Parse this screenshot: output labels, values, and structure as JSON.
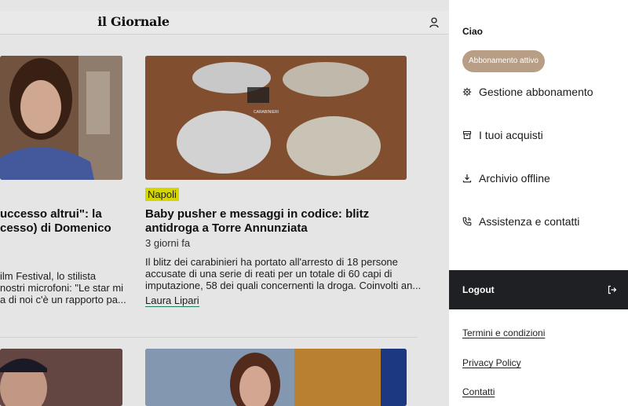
{
  "header": {
    "logo": "il Giornale",
    "user_icon": "user-icon"
  },
  "articles": {
    "left": {
      "title_line1": "uccesso altrui\": la",
      "title_line2": "cesso) di Domenico",
      "excerpt_line1": "ilm Festival, lo stilista",
      "excerpt_line2": "nostri microfoni: \"Le star mi",
      "excerpt_line3": "a di noi c'è un rapporto pa..."
    },
    "right": {
      "tag": "Napoli",
      "title_line1": "Baby pusher e messaggi in codice: blitz",
      "title_line2": "antidroga a Torre Annunziata",
      "date": "3 giorni fa",
      "excerpt_line1": "Il blitz dei carabinieri ha portato all'arresto di 18 persone",
      "excerpt_line2": "accusate di una serie di reati per un totale di 60 capi di",
      "excerpt_line3": "imputazione, 58 dei quali concernenti la droga. Coinvolti an...",
      "author": "Laura Lipari",
      "image_caption": "CARABINIERI"
    }
  },
  "menu": {
    "greeting": "Ciao",
    "badge": "Abbonamento attivo",
    "items": [
      {
        "label": "Gestione abbonamento",
        "icon": "gear-icon"
      },
      {
        "label": "I tuoi acquisti",
        "icon": "archive-box-icon"
      },
      {
        "label": "Archivio offline",
        "icon": "download-icon"
      },
      {
        "label": "Assistenza e contatti",
        "icon": "phone-icon"
      }
    ],
    "logout": "Logout",
    "footer_links": [
      "Termini e condizioni",
      "Privacy Policy",
      "Contatti"
    ]
  },
  "colors": {
    "badge": "#b79e84",
    "logout_bg": "#1f2023",
    "tag_bg": "#e6e600",
    "author_underline": "#1f8a5e"
  }
}
